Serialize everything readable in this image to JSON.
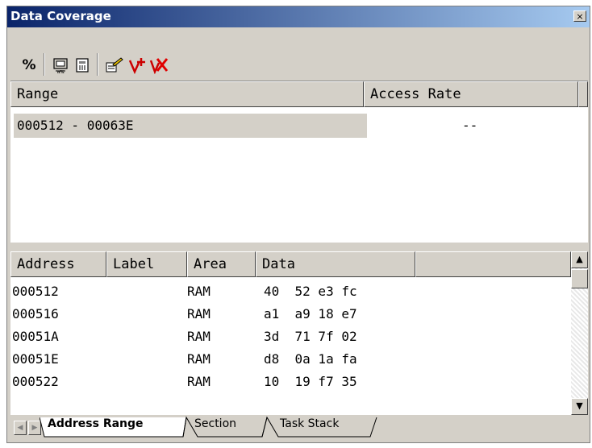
{
  "window": {
    "title": "Data Coverage",
    "close_label": "×"
  },
  "toolbar": {
    "buttons": [
      {
        "name": "percent-icon",
        "glyph": "%"
      },
      {
        "name": "coverage-icon",
        "glyph": ""
      },
      {
        "name": "memory-icon",
        "glyph": ""
      },
      {
        "name": "edit-range-icon",
        "glyph": ""
      },
      {
        "name": "add-range-icon",
        "glyph": ""
      },
      {
        "name": "delete-range-icon",
        "glyph": ""
      }
    ]
  },
  "range_table": {
    "headers": [
      "Range",
      "Access Rate"
    ],
    "rows": [
      {
        "range": "000512 - 00063E",
        "access_rate": "--"
      }
    ]
  },
  "data_table": {
    "headers": [
      "Address",
      "Label",
      "Area",
      "Data"
    ],
    "rows": [
      {
        "address": "000512",
        "label": "",
        "area": "RAM",
        "data": "40  52 e3 fc"
      },
      {
        "address": "000516",
        "label": "",
        "area": "RAM",
        "data": "a1  a9 18 e7"
      },
      {
        "address": "00051A",
        "label": "",
        "area": "RAM",
        "data": "3d  71 7f 02"
      },
      {
        "address": "00051E",
        "label": "",
        "area": "RAM",
        "data": "d8  0a 1a fa"
      },
      {
        "address": "000522",
        "label": "",
        "area": "RAM",
        "data": "10  19 f7 35"
      }
    ]
  },
  "tabs": [
    {
      "label": "Address Range",
      "active": true
    },
    {
      "label": "Section",
      "active": false
    },
    {
      "label": "Task Stack",
      "active": false
    }
  ],
  "scrollbar": {
    "up_glyph": "▲",
    "down_glyph": "▼"
  },
  "tab_nav": {
    "prev_glyph": "◀",
    "next_glyph": "▶"
  }
}
